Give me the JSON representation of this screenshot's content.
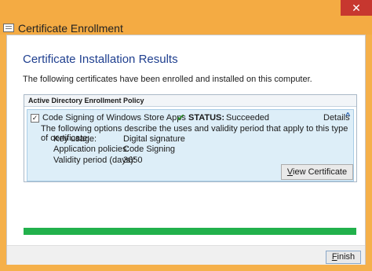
{
  "window": {
    "title": "Certificate Enrollment",
    "close_glyph": "✕"
  },
  "page": {
    "heading": "Certificate Installation Results",
    "description": "The following certificates have been enrolled and installed on this computer."
  },
  "policy_group": {
    "header": "Active Directory Enrollment Policy",
    "certificate": {
      "checked": true,
      "name": "Code Signing of Windows Store Apps",
      "status_label": "STATUS:",
      "status_value": "Succeeded",
      "details_label": "Details",
      "options_description": "The following options describe the uses and validity period that apply to this type of certificate:",
      "properties": [
        {
          "label": "Key usage:",
          "value": "Digital signature"
        },
        {
          "label": "Application policies:",
          "value": "Code Signing"
        },
        {
          "label": "Validity period (days):",
          "value": "3650"
        }
      ],
      "view_button": {
        "prefix": "V",
        "rest": "iew Certificate"
      }
    }
  },
  "progress": {
    "value": 1.0
  },
  "footer": {
    "finish_button": {
      "prefix": "F",
      "rest": "inish"
    }
  },
  "colors": {
    "accent_window": "#f4ab43",
    "heading": "#1f3f8f",
    "success": "#22b14c",
    "selection_bg": "#ddeef8"
  },
  "icons": {
    "app": "certificate-app-icon",
    "status": "checkmark-icon",
    "details": "chevron-up-icon",
    "close": "close-icon"
  }
}
